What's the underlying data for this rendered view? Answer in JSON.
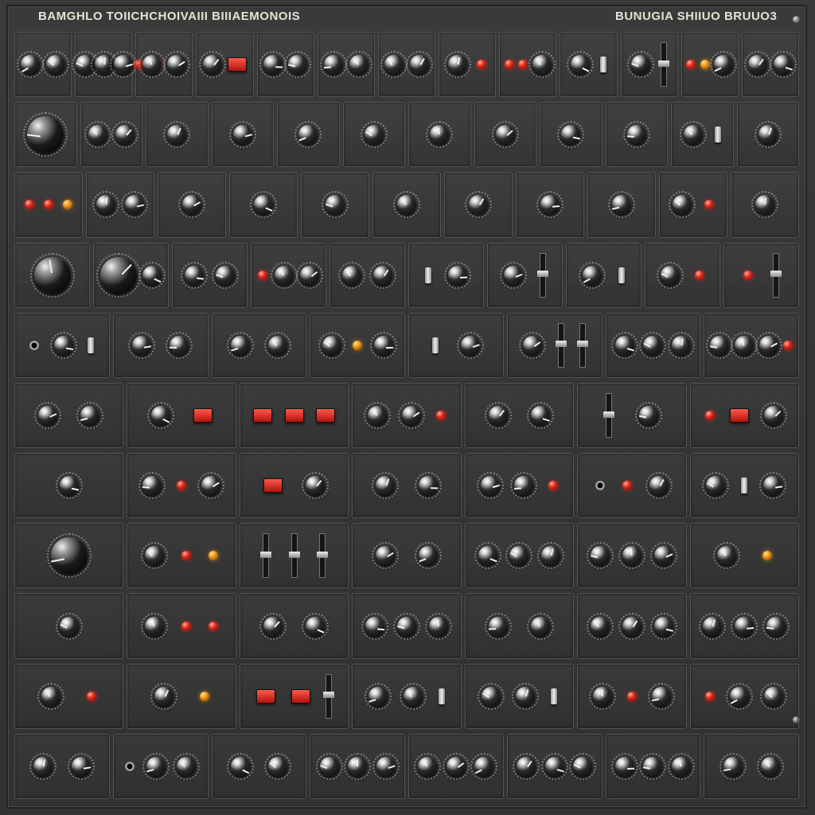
{
  "panel": {
    "title_left": "BAMGHLO TOIICHCHOIVAIII BIIIAEMONOIS",
    "title_right": "BUNUGIA SHIIUO BRUUO3"
  },
  "rows": [
    {
      "modules": [
        {
          "label": "",
          "controls": [
            "knob",
            "knob"
          ]
        },
        {
          "label": "",
          "controls": [
            "knob",
            "knob",
            "knob",
            "led",
            "led",
            "led"
          ]
        },
        {
          "label": "",
          "controls": [
            "knob",
            "knob"
          ]
        },
        {
          "label": "",
          "controls": [
            "knob",
            "button"
          ]
        },
        {
          "label": "",
          "controls": [
            "knob",
            "knob"
          ]
        },
        {
          "label": "",
          "controls": [
            "knob",
            "knob"
          ]
        },
        {
          "label": "",
          "controls": [
            "knob",
            "knob"
          ]
        },
        {
          "label": "",
          "controls": [
            "knob",
            "led"
          ]
        },
        {
          "label": "",
          "controls": [
            "led",
            "led",
            "knob"
          ]
        },
        {
          "label": "",
          "controls": [
            "knob",
            "switch"
          ]
        },
        {
          "label": "",
          "controls": [
            "knob",
            "fader"
          ]
        },
        {
          "label": "",
          "controls": [
            "led",
            "amber",
            "knob"
          ]
        },
        {
          "label": "",
          "controls": [
            "knob",
            "knob"
          ]
        }
      ]
    },
    {
      "modules": [
        {
          "label": "",
          "controls": [
            "bigknob"
          ]
        },
        {
          "label": "",
          "controls": [
            "knob",
            "knob"
          ]
        },
        {
          "label": "",
          "controls": [
            "knob"
          ]
        },
        {
          "label": "",
          "controls": [
            "knob"
          ]
        },
        {
          "label": "",
          "controls": [
            "knob"
          ]
        },
        {
          "label": "",
          "controls": [
            "knob"
          ]
        },
        {
          "label": "",
          "controls": [
            "knob"
          ]
        },
        {
          "label": "",
          "controls": [
            "knob"
          ]
        },
        {
          "label": "",
          "controls": [
            "knob"
          ]
        },
        {
          "label": "",
          "controls": [
            "knob"
          ]
        },
        {
          "label": "",
          "controls": [
            "knob",
            "switch"
          ]
        },
        {
          "label": "",
          "controls": [
            "knob"
          ]
        }
      ]
    },
    {
      "modules": [
        {
          "label": "",
          "controls": [
            "led",
            "led",
            "amber"
          ]
        },
        {
          "label": "",
          "controls": [
            "knob",
            "knob"
          ]
        },
        {
          "label": "",
          "controls": [
            "knob"
          ]
        },
        {
          "label": "",
          "controls": [
            "knob"
          ]
        },
        {
          "label": "",
          "controls": [
            "knob"
          ]
        },
        {
          "label": "",
          "controls": [
            "knob"
          ]
        },
        {
          "label": "",
          "controls": [
            "knob"
          ]
        },
        {
          "label": "",
          "controls": [
            "knob"
          ]
        },
        {
          "label": "",
          "controls": [
            "knob"
          ]
        },
        {
          "label": "",
          "controls": [
            "knob",
            "led"
          ]
        },
        {
          "label": "",
          "controls": [
            "knob"
          ]
        }
      ]
    },
    {
      "modules": [
        {
          "label": "",
          "controls": [
            "bigknob"
          ]
        },
        {
          "label": "",
          "controls": [
            "bigknob",
            "knob"
          ]
        },
        {
          "label": "",
          "controls": [
            "knob",
            "knob"
          ]
        },
        {
          "label": "",
          "controls": [
            "led",
            "knob",
            "knob"
          ]
        },
        {
          "label": "",
          "controls": [
            "knob",
            "knob"
          ]
        },
        {
          "label": "",
          "controls": [
            "switch",
            "knob"
          ]
        },
        {
          "label": "",
          "controls": [
            "knob",
            "fader"
          ]
        },
        {
          "label": "",
          "controls": [
            "knob",
            "switch"
          ]
        },
        {
          "label": "",
          "controls": [
            "knob",
            "led"
          ]
        },
        {
          "label": "",
          "controls": [
            "led",
            "fader"
          ]
        }
      ]
    },
    {
      "modules": [
        {
          "label": "",
          "controls": [
            "jack",
            "knob",
            "switch"
          ]
        },
        {
          "label": "",
          "controls": [
            "knob",
            "knob"
          ]
        },
        {
          "label": "",
          "controls": [
            "knob",
            "knob"
          ]
        },
        {
          "label": "",
          "controls": [
            "knob",
            "amber",
            "knob"
          ]
        },
        {
          "label": "",
          "controls": [
            "switch",
            "knob"
          ]
        },
        {
          "label": "",
          "controls": [
            "knob",
            "fader",
            "fader"
          ]
        },
        {
          "label": "",
          "controls": [
            "knob",
            "knob",
            "knob"
          ]
        },
        {
          "label": "",
          "controls": [
            "knob",
            "knob",
            "knob",
            "led"
          ]
        }
      ]
    },
    {
      "modules": [
        {
          "label": "",
          "controls": [
            "knob",
            "knob"
          ]
        },
        {
          "label": "",
          "controls": [
            "knob",
            "button"
          ]
        },
        {
          "label": "",
          "controls": [
            "button",
            "button",
            "button"
          ]
        },
        {
          "label": "",
          "controls": [
            "knob",
            "knob",
            "led"
          ]
        },
        {
          "label": "",
          "controls": [
            "knob",
            "knob"
          ]
        },
        {
          "label": "",
          "controls": [
            "fader",
            "knob"
          ]
        },
        {
          "label": "",
          "controls": [
            "led",
            "button",
            "knob"
          ]
        }
      ]
    },
    {
      "modules": [
        {
          "label": "",
          "controls": [
            "knob"
          ]
        },
        {
          "label": "",
          "controls": [
            "knob",
            "led",
            "knob"
          ]
        },
        {
          "label": "",
          "controls": [
            "button",
            "knob"
          ]
        },
        {
          "label": "",
          "controls": [
            "knob",
            "knob"
          ]
        },
        {
          "label": "",
          "controls": [
            "knob",
            "knob",
            "led"
          ]
        },
        {
          "label": "",
          "controls": [
            "jack",
            "led",
            "knob"
          ]
        },
        {
          "label": "",
          "controls": [
            "knob",
            "switch",
            "knob"
          ]
        }
      ]
    },
    {
      "modules": [
        {
          "label": "",
          "controls": [
            "bigknob"
          ]
        },
        {
          "label": "",
          "controls": [
            "knob",
            "led",
            "amber"
          ]
        },
        {
          "label": "",
          "controls": [
            "fader",
            "fader",
            "fader"
          ]
        },
        {
          "label": "",
          "controls": [
            "knob",
            "knob"
          ]
        },
        {
          "label": "",
          "controls": [
            "knob",
            "knob",
            "knob"
          ]
        },
        {
          "label": "",
          "controls": [
            "knob",
            "knob",
            "knob"
          ]
        },
        {
          "label": "",
          "controls": [
            "knob",
            "amber"
          ]
        }
      ]
    },
    {
      "modules": [
        {
          "label": "",
          "controls": [
            "knob"
          ]
        },
        {
          "label": "",
          "controls": [
            "knob",
            "led",
            "led"
          ]
        },
        {
          "label": "",
          "controls": [
            "knob",
            "knob"
          ]
        },
        {
          "label": "",
          "controls": [
            "knob",
            "knob",
            "knob"
          ]
        },
        {
          "label": "",
          "controls": [
            "knob",
            "knob"
          ]
        },
        {
          "label": "",
          "controls": [
            "knob",
            "knob",
            "knob"
          ]
        },
        {
          "label": "",
          "controls": [
            "knob",
            "knob",
            "knob"
          ]
        }
      ]
    },
    {
      "modules": [
        {
          "label": "",
          "controls": [
            "knob",
            "led"
          ]
        },
        {
          "label": "",
          "controls": [
            "knob",
            "amber"
          ]
        },
        {
          "label": "",
          "controls": [
            "button",
            "button",
            "fader"
          ]
        },
        {
          "label": "",
          "controls": [
            "knob",
            "knob",
            "switch"
          ]
        },
        {
          "label": "",
          "controls": [
            "knob",
            "knob",
            "switch"
          ]
        },
        {
          "label": "",
          "controls": [
            "knob",
            "led",
            "knob"
          ]
        },
        {
          "label": "",
          "controls": [
            "led",
            "knob",
            "knob"
          ]
        }
      ]
    },
    {
      "modules": [
        {
          "label": "",
          "controls": [
            "knob",
            "knob"
          ]
        },
        {
          "label": "",
          "controls": [
            "jack",
            "knob",
            "knob"
          ]
        },
        {
          "label": "",
          "controls": [
            "knob",
            "knob"
          ]
        },
        {
          "label": "",
          "controls": [
            "knob",
            "knob",
            "knob"
          ]
        },
        {
          "label": "",
          "controls": [
            "knob",
            "knob",
            "knob"
          ]
        },
        {
          "label": "",
          "controls": [
            "knob",
            "knob",
            "knob"
          ]
        },
        {
          "label": "",
          "controls": [
            "knob",
            "knob",
            "knob"
          ]
        },
        {
          "label": "",
          "controls": [
            "knob",
            "knob"
          ]
        }
      ]
    }
  ]
}
